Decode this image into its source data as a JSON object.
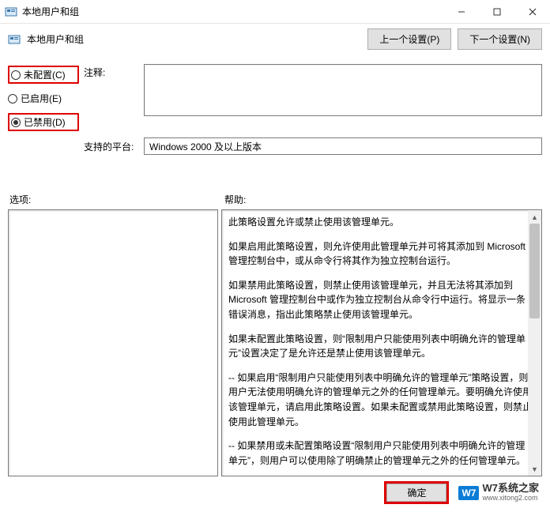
{
  "window": {
    "title": "本地用户和组",
    "minimize_tooltip": "minimize",
    "maximize_tooltip": "maximize",
    "close_tooltip": "close"
  },
  "header": {
    "title": "本地用户和组",
    "prev_btn": "上一个设置(P)",
    "next_btn": "下一个设置(N)"
  },
  "radios": {
    "not_configured": "未配置(C)",
    "enabled": "已启用(E)",
    "disabled": "已禁用(D)"
  },
  "labels": {
    "comment": "注释:",
    "platform": "支持的平台:",
    "options": "选项:",
    "help": "帮助:"
  },
  "platform_value": "Windows 2000 及以上版本",
  "help_paragraphs": [
    "此策略设置允许或禁止使用该管理单元。",
    "如果启用此策略设置，则允许使用此管理单元并可将其添加到 Microsoft 管理控制台中，或从命令行将其作为独立控制台运行。",
    "如果禁用此策略设置，则禁止使用该管理单元，并且无法将其添加到 Microsoft 管理控制台中或作为独立控制台从命令行中运行。将显示一条错误消息，指出此策略禁止使用该管理单元。",
    "如果未配置此策略设置，则“限制用户只能使用列表中明确允许的管理单元”设置决定了是允许还是禁止使用该管理单元。",
    "--  如果启用“限制用户只能使用列表中明确允许的管理单元”策略设置，则用户无法使用明确允许的管理单元之外的任何管理单元。要明确允许使用该管理单元，请启用此策略设置。如果未配置或禁用此策略设置，则禁止使用此管理单元。",
    "--  如果禁用或未配置策略设置“限制用户只能使用列表中明确允许的管理单元”，则用户可以使用除了明确禁止的管理单元之外的任何管理单元。"
  ],
  "buttons": {
    "ok": "确定"
  },
  "watermark": {
    "badge": "W7",
    "text": "W7系统之家",
    "url": "www.xitong2.com"
  }
}
